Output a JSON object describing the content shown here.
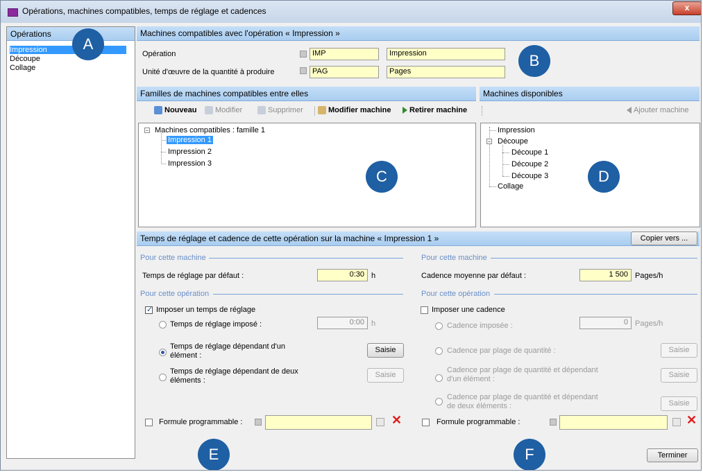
{
  "window": {
    "title": "Opérations, machines compatibles, temps de réglage et cadences",
    "close": "x"
  },
  "operations": {
    "header": "Opérations",
    "items": [
      "Impression",
      "Découpe",
      "Collage"
    ]
  },
  "machines_header": "Machines compatibles avec l'opération « Impression »",
  "fields": {
    "operation_label": "Opération",
    "operation_code": "IMP",
    "operation_name": "Impression",
    "unit_label": "Unité d'œuvre de la quantité à produire",
    "unit_code": "PAG",
    "unit_name": "Pages"
  },
  "families": {
    "header": "Familles de machines compatibles entre elles",
    "toolbar": {
      "new": "Nouveau",
      "edit": "Modifier",
      "delete": "Supprimer",
      "edit_machine": "Modifier machine",
      "remove_machine": "Retirer machine"
    },
    "root": "Machines compatibles : famille 1",
    "items": [
      "Impression 1",
      "Impression 2",
      "Impression 3"
    ]
  },
  "available": {
    "header": "Machines disponibles",
    "add": "Ajouter machine",
    "impression": "Impression",
    "decoupe": "Découpe",
    "decoupe_items": [
      "Découpe 1",
      "Découpe 2",
      "Découpe 3"
    ],
    "collage": "Collage"
  },
  "settings": {
    "header": "Temps de réglage et cadence de cette opération sur la machine « Impression 1 »",
    "copy_button": "Copier vers ...",
    "left": {
      "section_machine": "Pour cette machine",
      "default_time_label": "Temps de réglage par défaut :",
      "default_time": "0:30",
      "unit": "h",
      "section_operation": "Pour cette opération",
      "impose_label": "Imposer un temps de réglage",
      "opt1": "Temps de réglage imposé :",
      "opt1_value": "0:00",
      "opt1_unit": "h",
      "opt2_line1": "Temps de réglage dépendant d'un",
      "opt2_line2": "élément :",
      "opt3_line1": "Temps de réglage dépendant de deux",
      "opt3_line2": "éléments :",
      "saisie": "Saisie",
      "formula": "Formule programmable :"
    },
    "right": {
      "section_machine": "Pour cette machine",
      "default_rate_label": "Cadence moyenne par défaut :",
      "default_rate": "1 500",
      "unit": "Pages/h",
      "section_operation": "Pour cette opération",
      "impose_label": "Imposer une cadence",
      "opt1": "Cadence imposée :",
      "opt1_value": "0",
      "opt1_unit": "Pages/h",
      "opt2": "Cadence par plage de quantité :",
      "opt3_line1": "Cadence par plage de quantité et dépendant",
      "opt3_line2": "d'un élément :",
      "opt4_line1": "Cadence par plage de quantité et dépendant",
      "opt4_line2": "de deux éléments :",
      "saisie": "Saisie",
      "formula": "Formule programmable :"
    }
  },
  "finish_button": "Terminer",
  "badges": [
    "A",
    "B",
    "C",
    "D",
    "E",
    "F"
  ],
  "colors": {
    "header_blue": "#a9cdf0",
    "field_yellow": "#ffffc8",
    "badge": "#1f5fa3",
    "selection": "#3399ff"
  }
}
